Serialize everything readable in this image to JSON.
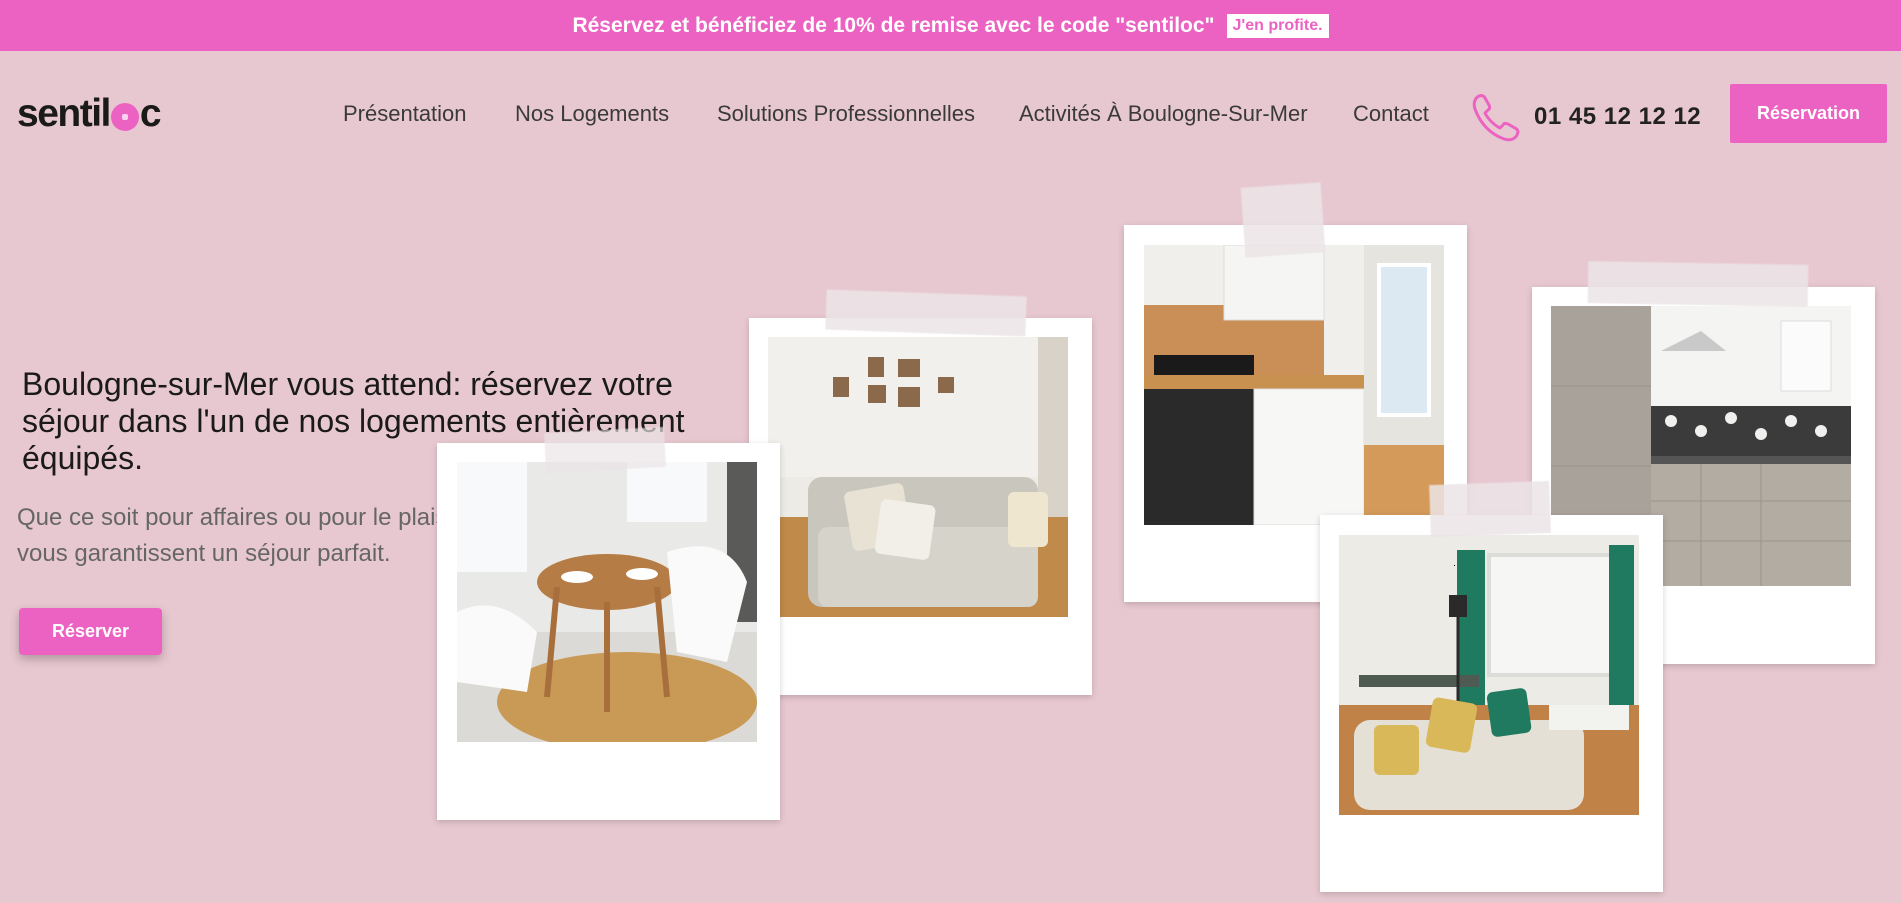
{
  "promo": {
    "text": "Réservez et bénéficiez de 10% de remise avec le code \"sentiloc\"",
    "button": "J'en profite."
  },
  "logo": {
    "text_start": "sentil",
    "text_end": "c"
  },
  "nav": {
    "items": [
      "Présentation",
      "Nos Logements",
      "Solutions Professionnelles",
      "Activités À Boulogne-Sur-Mer",
      "Contact"
    ]
  },
  "phone": {
    "number": "01 45 12 12 12",
    "icon": "phone-icon"
  },
  "header_cta": {
    "label": "Réservation"
  },
  "hero": {
    "title": "Boulogne-sur-Mer vous attend: réservez votre séjour dans l'un de nos logements entièrement équipés.",
    "subtitle": "Que ce soit pour affaires ou pour le plaisir, nos locations vous garantissent un séjour parfait.",
    "button": "Réserver"
  },
  "colors": {
    "accent": "#ec62c2",
    "background": "#e8c8d0"
  },
  "gallery": {
    "photos": [
      "living-room-photo",
      "kitchen-photo",
      "dining-table-photo",
      "kitchen-tiles-photo",
      "sofa-living-photo"
    ]
  }
}
